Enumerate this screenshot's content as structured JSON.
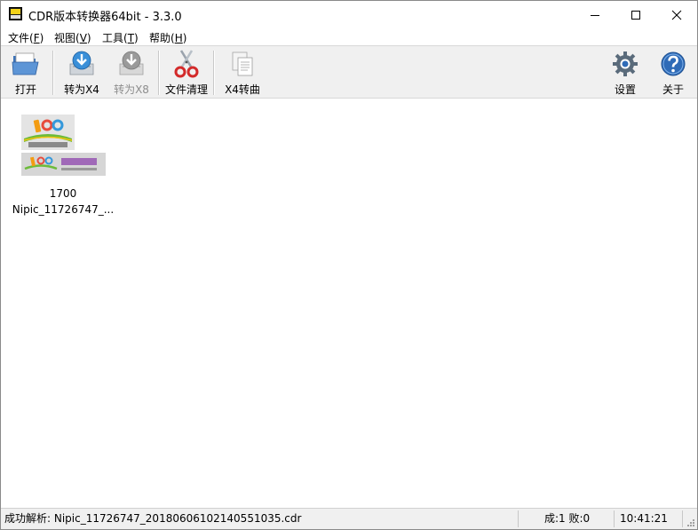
{
  "window": {
    "title": "CDR版本转换器64bit - 3.3.0",
    "app_icon_text_top": "CDR",
    "app_icon_text_bottom": "Version"
  },
  "menu": {
    "items": [
      {
        "label": "文件(",
        "key": "F",
        "end": ")"
      },
      {
        "label": "视图(",
        "key": "V",
        "end": ")"
      },
      {
        "label": "工具(",
        "key": "T",
        "end": ")"
      },
      {
        "label": "帮助(",
        "key": "H",
        "end": ")"
      }
    ]
  },
  "toolbar": {
    "open_label": "打开",
    "to_x4_label": "转为X4",
    "to_x8_label": "转为X8",
    "clean_label": "文件清理",
    "x4_convert_label": "X4转曲",
    "settings_label": "设置",
    "about_label": "关于"
  },
  "files": [
    {
      "line1": "1700",
      "line2": "Nipic_11726747_..."
    }
  ],
  "statusbar": {
    "message": "成功解析:  Nipic_11726747_20180606102140551035.cdr",
    "counts": "成:1 败:0",
    "time": "10:41:21"
  },
  "colors": {
    "toolbar_bg": "#f0f0f0",
    "folder_blue": "#4a86c8",
    "scissors_red": "#d32a2a",
    "settings_gray": "#5a6b7b",
    "about_blue": "#2f6bb7"
  }
}
